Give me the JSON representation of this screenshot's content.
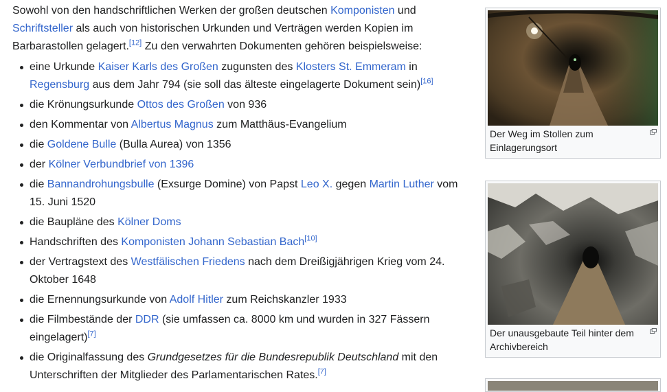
{
  "intro": {
    "t1": "Sowohl von den handschriftlichen Werken der großen deutschen ",
    "link_komponisten": "Komponisten",
    "t2": " und ",
    "link_schriftsteller": "Schriftsteller",
    "t3": " als auch von historischen Urkunden und Verträgen werden Kopien im Barbarastollen gelagert.",
    "ref12": "[12]",
    "t4": " Zu den verwahrten Dokumenten gehören beispielsweise:"
  },
  "items": [
    {
      "segs": [
        {
          "t": "eine Urkunde "
        },
        {
          "l": "Kaiser Karls des Großen"
        },
        {
          "t": " zugunsten des "
        },
        {
          "l": "Klosters St. Emmeram"
        },
        {
          "t": " in "
        },
        {
          "l": "Regensburg"
        },
        {
          "t": " aus dem Jahr 794 (sie soll das älteste eingelagerte Dokument sein)"
        },
        {
          "r": "[16]"
        }
      ]
    },
    {
      "segs": [
        {
          "t": "die Krönungsurkunde "
        },
        {
          "l": "Ottos des Großen"
        },
        {
          "t": " von 936"
        }
      ]
    },
    {
      "segs": [
        {
          "t": "den Kommentar von "
        },
        {
          "l": "Albertus Magnus"
        },
        {
          "t": " zum Matthäus-Evangelium"
        }
      ]
    },
    {
      "segs": [
        {
          "t": "die "
        },
        {
          "l": "Goldene Bulle"
        },
        {
          "t": " (Bulla Aurea) von 1356"
        }
      ]
    },
    {
      "segs": [
        {
          "t": "der "
        },
        {
          "l": "Kölner Verbundbrief von 1396"
        }
      ]
    },
    {
      "segs": [
        {
          "t": "die "
        },
        {
          "l": "Bannandrohungsbulle"
        },
        {
          "t": " (Exsurge Domine) von Papst "
        },
        {
          "l": "Leo X."
        },
        {
          "t": " gegen "
        },
        {
          "l": "Martin Luther"
        },
        {
          "t": " vom 15. Juni 1520"
        }
      ]
    },
    {
      "segs": [
        {
          "t": "die Baupläne des "
        },
        {
          "l": "Kölner Doms"
        }
      ]
    },
    {
      "segs": [
        {
          "t": "Handschriften des "
        },
        {
          "l": "Komponisten Johann Sebastian Bach"
        },
        {
          "r": "[10]"
        }
      ]
    },
    {
      "segs": [
        {
          "t": "der Vertragstext des "
        },
        {
          "l": "Westfälischen Friedens"
        },
        {
          "t": " nach dem Dreißigjährigen Krieg vom 24. Oktober 1648"
        }
      ]
    },
    {
      "segs": [
        {
          "t": "die Ernennungsurkunde von "
        },
        {
          "l": "Adolf Hitler"
        },
        {
          "t": " zum Reichskanzler 1933"
        }
      ]
    },
    {
      "segs": [
        {
          "t": "die Filmbestände der "
        },
        {
          "l": "DDR"
        },
        {
          "t": " (sie umfassen ca. 8000 km und wurden in 327 Fässern eingelagert)"
        },
        {
          "r": "[7]"
        }
      ]
    },
    {
      "segs": [
        {
          "t": "die Originalfassung des "
        },
        {
          "i": "Grundgesetzes für die Bundesrepublik Deutschland"
        },
        {
          "t": " mit den Unterschriften der Mitglieder des Parlamentarischen Rates."
        },
        {
          "r": "[7]"
        }
      ]
    }
  ],
  "thumbs": [
    {
      "caption": "Der Weg im Stollen zum Einlagerungsort"
    },
    {
      "caption": "Der unausgebaute Teil hinter dem Archivbereich"
    }
  ]
}
